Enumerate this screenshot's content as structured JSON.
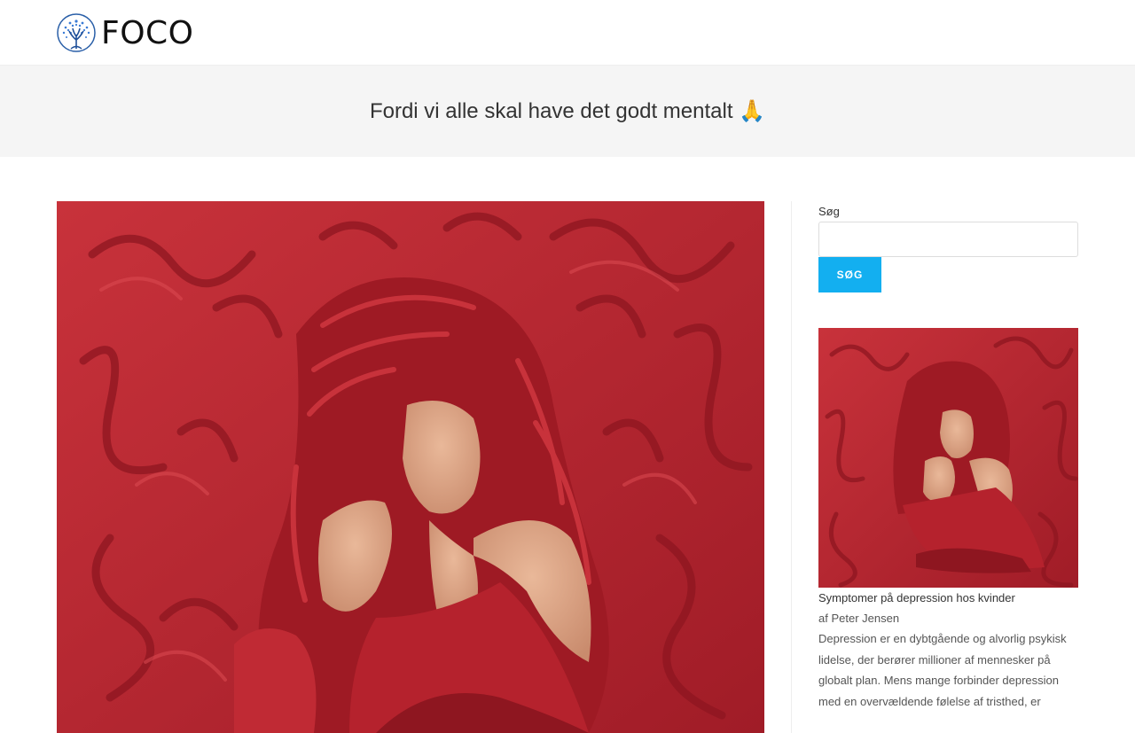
{
  "header": {
    "logo_text": "FOCO"
  },
  "banner": {
    "title": "Fordi vi alle skal have det godt mentalt 🙏"
  },
  "sidebar": {
    "search_label": "Søg",
    "search_placeholder": "",
    "search_button": "SØG",
    "post": {
      "title": "Symptomer på depression hos kvinder",
      "author": "af Peter Jensen",
      "excerpt": "Depression er en dybtgående og alvorlig psykisk lidelse, der berører millioner af mennesker på globalt plan. Mens mange forbinder depression med en overvældende følelse af tristhed, er"
    }
  },
  "colors": {
    "accent": "#13aff0",
    "banner_bg": "#f5f5f5",
    "image_red": "#b8262f"
  }
}
